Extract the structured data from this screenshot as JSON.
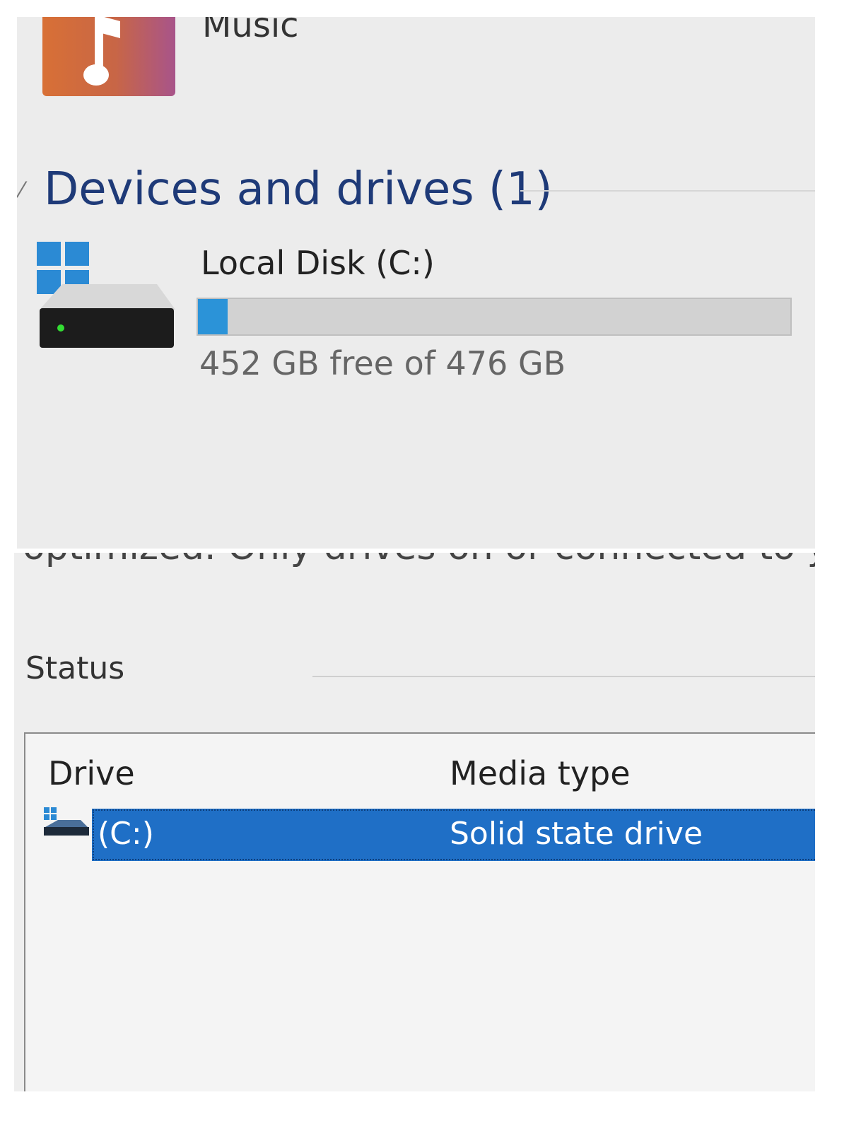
{
  "explorer": {
    "music_label": "Music",
    "group_header": "Devices and drives (1)",
    "drive": {
      "name": "Local Disk (C:)",
      "capacity_text": "452 GB free of 476 GB",
      "used_fraction": 0.05,
      "bar_color": "#2b93d8"
    },
    "icons": [
      "music-folder-icon",
      "windows-drive-icon"
    ]
  },
  "optimize": {
    "cut_text": "optimized. Only drives on or connected to your co",
    "status_label": "Status",
    "columns": [
      "Drive",
      "Media type"
    ],
    "rows": [
      {
        "drive": "(C:)",
        "media_type": "Solid state drive",
        "selected": true
      }
    ],
    "selection_color": "#1f6fc6"
  }
}
